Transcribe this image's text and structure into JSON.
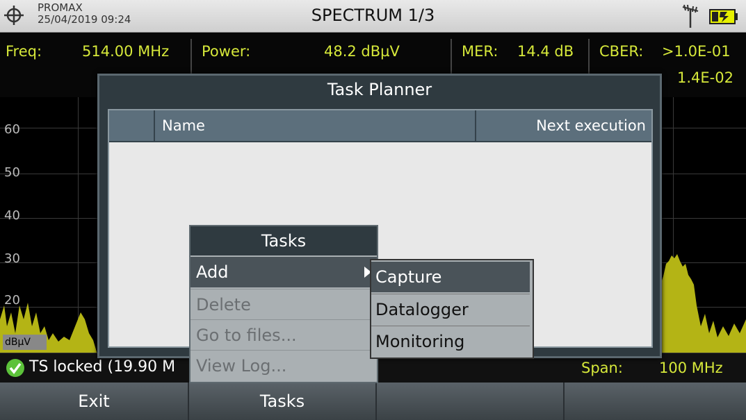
{
  "topbar": {
    "brand": "PROMAX",
    "datetime": "25/04/2019 09:24",
    "title": "SPECTRUM 1/3"
  },
  "measurements": {
    "freq_label": "Freq:",
    "freq_value": "514.00 MHz",
    "power_label": "Power:",
    "power_value": "48.2 dBµV",
    "mer_label": "MER:",
    "mer_value": "14.4 dB",
    "cber_label": "CBER:",
    "cber_value": ">1.0E-01",
    "vber_value": "1.4E-02"
  },
  "chart": {
    "ylabels": [
      "60",
      "50",
      "40",
      "30",
      "20"
    ],
    "unit": "dBµV"
  },
  "status": {
    "lock_text": "TS locked (19.90 M",
    "span_label": "Span:",
    "span_value": "100 MHz"
  },
  "softkeys": [
    "Exit",
    "Tasks",
    "",
    ""
  ],
  "dialog": {
    "title": "Task Planner",
    "col_name": "Name",
    "col_next": "Next execution"
  },
  "tasks_menu": {
    "header": "Tasks",
    "items": [
      {
        "label": "Add",
        "enabled": true
      },
      {
        "label": "Delete",
        "enabled": false
      },
      {
        "label": "Go to files...",
        "enabled": false
      },
      {
        "label": "View Log...",
        "enabled": false
      }
    ]
  },
  "submenu": {
    "items": [
      "Capture",
      "Datalogger",
      "Monitoring"
    ]
  },
  "colors": {
    "measurement_text": "#d6e83a",
    "spectrum_fill": "#b4b415",
    "lock_ok": "#5cc23a"
  }
}
